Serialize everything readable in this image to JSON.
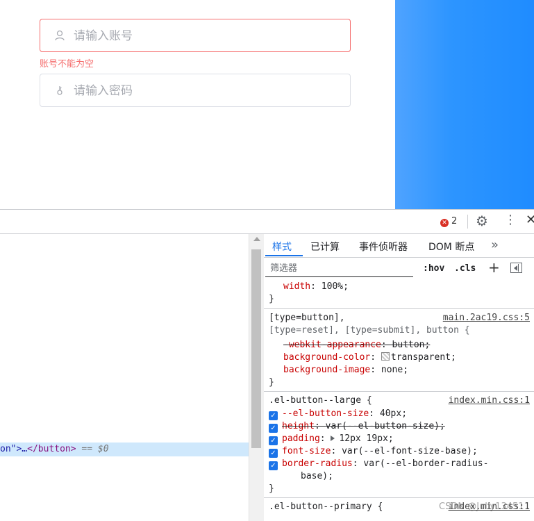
{
  "login_form": {
    "account_placeholder": "请输入账号",
    "account_error": "账号不能为空",
    "password_placeholder": "请输入密码"
  },
  "devtools": {
    "error_count": "2",
    "elements": {
      "selected_line": {
        "attr_tail": "on\">…",
        "close_tag": "</button>",
        "eq": "== $0"
      }
    },
    "tabs": [
      "样式",
      "已计算",
      "事件侦听器",
      "DOM 断点"
    ],
    "more_tabs": "»",
    "filter_placeholder": "筛选器",
    "filter_buttons": {
      "hov": ":hov",
      "cls": ".cls",
      "plus": "+"
    },
    "rules": {
      "r0": {
        "prop": "width",
        "value": "100%;",
        "close": "}"
      },
      "r1": {
        "selector1": "[type=button],",
        "selector2": "[type=reset], [type=submit], button {",
        "source": "main.2ac19.css:5",
        "decls": [
          {
            "prop": "-webkit-appearance",
            "value": "button;"
          },
          {
            "prop": "background-color",
            "value": "transparent;"
          },
          {
            "prop": "background-image",
            "value": "none;"
          }
        ],
        "close": "}"
      },
      "r2": {
        "selector": ".el-button--large {",
        "source": "index.min.css:1",
        "decls": [
          {
            "prop": "--el-button-size",
            "value": "40px;"
          },
          {
            "prop": "height",
            "value": "var(--el-button-size);"
          },
          {
            "prop": "padding",
            "value": "12px 19px;"
          },
          {
            "prop": "font-size",
            "value": "var(--el-font-size-base);"
          },
          {
            "prop": "border-radius",
            "value": "var(--el-border-radius-"
          },
          {
            "prop": "",
            "value": "base);"
          }
        ],
        "close": "}"
      },
      "r3": {
        "selector": ".el-button--primary {",
        "source": "index.min.css:1"
      }
    }
  },
  "watermark": "CSDN @Jully13451",
  "colors": {
    "accent": "#1a73e8",
    "error": "#f56c6c",
    "panel_blue": "#1f8cff"
  }
}
